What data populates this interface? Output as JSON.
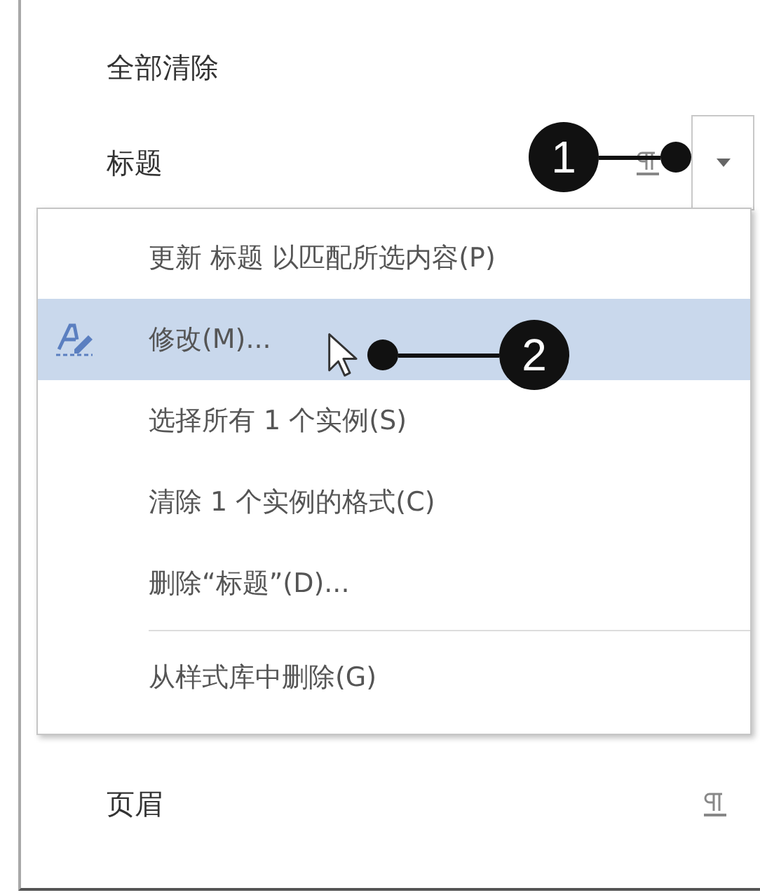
{
  "styles": [
    {
      "name": "全部清除",
      "kind": "plain"
    },
    {
      "name": "标题",
      "kind": "style",
      "dropdown": true
    },
    {
      "name": "页眉",
      "kind": "style",
      "dropdown": false
    }
  ],
  "context_menu": {
    "items": [
      {
        "label": "更新 标题 以匹配所选内容(P)",
        "kind": "item",
        "selected": false,
        "icon": false
      },
      {
        "label": "修改(M)...",
        "kind": "item",
        "selected": true,
        "icon": true
      },
      {
        "label": "选择所有 1 个实例(S)",
        "kind": "item",
        "selected": false,
        "icon": false
      },
      {
        "label": "清除 1 个实例的格式(C)",
        "kind": "item",
        "selected": false,
        "icon": false
      },
      {
        "label": "删除“标题”(D)...",
        "kind": "item",
        "selected": false,
        "icon": false
      },
      {
        "kind": "separator"
      },
      {
        "label": "从样式库中删除(G)",
        "kind": "item",
        "selected": false,
        "icon": false
      }
    ]
  },
  "callouts": [
    {
      "number": "1"
    },
    {
      "number": "2"
    }
  ]
}
